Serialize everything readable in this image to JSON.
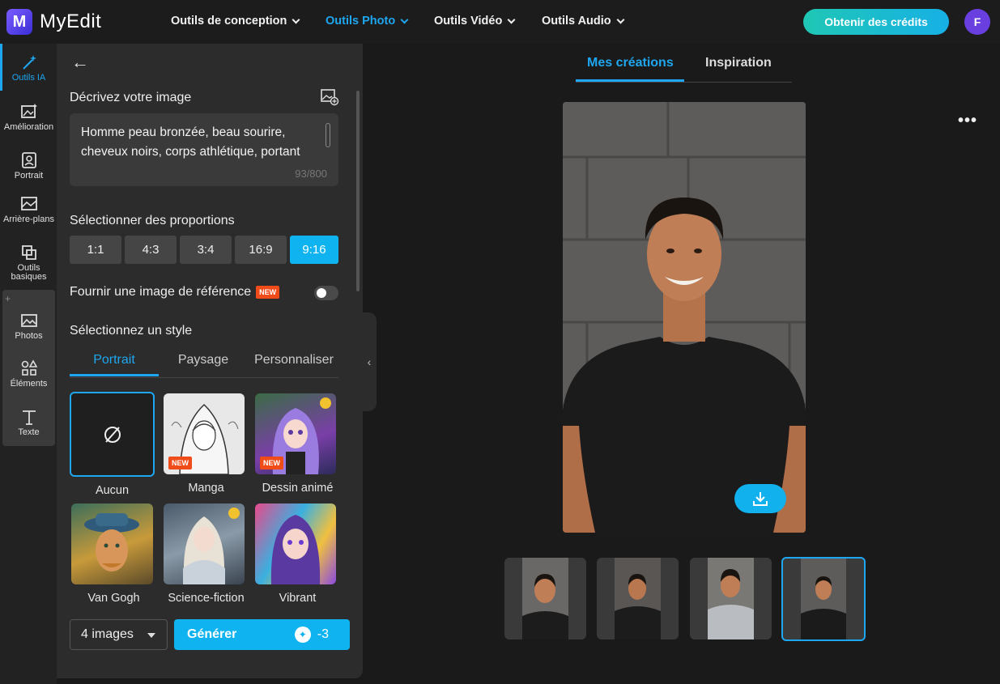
{
  "app": {
    "name": "MyEdit",
    "logo_letter": "M",
    "accent": "#1ea7f0"
  },
  "nav": {
    "items": [
      {
        "label": "Outils de conception",
        "active": false
      },
      {
        "label": "Outils Photo",
        "active": true
      },
      {
        "label": "Outils Vidéo",
        "active": false
      },
      {
        "label": "Outils Audio",
        "active": false
      }
    ],
    "credits_button": "Obtenir des crédits",
    "avatar_initial": "F"
  },
  "rail": {
    "items": [
      {
        "label": "Outils IA",
        "icon": "magic-wand-icon",
        "active": true
      },
      {
        "label": "Amélioration",
        "icon": "image-enhance-icon"
      },
      {
        "label": "Portrait",
        "icon": "portrait-icon"
      },
      {
        "label": "Arrière-plans",
        "icon": "background-icon"
      },
      {
        "label": "Outils basiques",
        "icon": "crop-icon"
      },
      {
        "label": "Photos",
        "icon": "photo-icon"
      },
      {
        "label": "Éléments",
        "icon": "shapes-icon"
      },
      {
        "label": "Texte",
        "icon": "text-icon"
      }
    ],
    "plus": "+"
  },
  "panel": {
    "describe_label": "Décrivez votre image",
    "prompt_text": "Homme peau bronzée, beau sourire, cheveux noirs, corps athlétique, portant",
    "prompt_count": "93/800",
    "ratio_label": "Sélectionner des proportions",
    "ratios": [
      "1:1",
      "4:3",
      "3:4",
      "16:9",
      "9:16"
    ],
    "selected_ratio": "9:16",
    "reference_label": "Fournir une image de référence",
    "new_badge": "NEW",
    "reference_enabled": false,
    "style_label": "Sélectionnez un style",
    "style_tabs": [
      "Portrait",
      "Paysage",
      "Personnaliser"
    ],
    "styles": [
      {
        "name": "Aucun",
        "badge": "",
        "premium": false,
        "selected": true
      },
      {
        "name": "Manga",
        "badge": "NEW",
        "premium": false
      },
      {
        "name": "Dessin animé",
        "badge": "NEW",
        "premium": true
      },
      {
        "name": "Van Gogh",
        "badge": "",
        "premium": false
      },
      {
        "name": "Science-fiction",
        "badge": "",
        "premium": true
      },
      {
        "name": "Vibrant",
        "badge": "",
        "premium": false
      }
    ],
    "image_count": "4 images",
    "generate_label": "Générer",
    "generate_cost": "-3"
  },
  "main": {
    "tabs": [
      "Mes créations",
      "Inspiration"
    ],
    "active_tab": "Mes créations",
    "more": "•••",
    "results_count": 4,
    "selected_result": 4
  }
}
